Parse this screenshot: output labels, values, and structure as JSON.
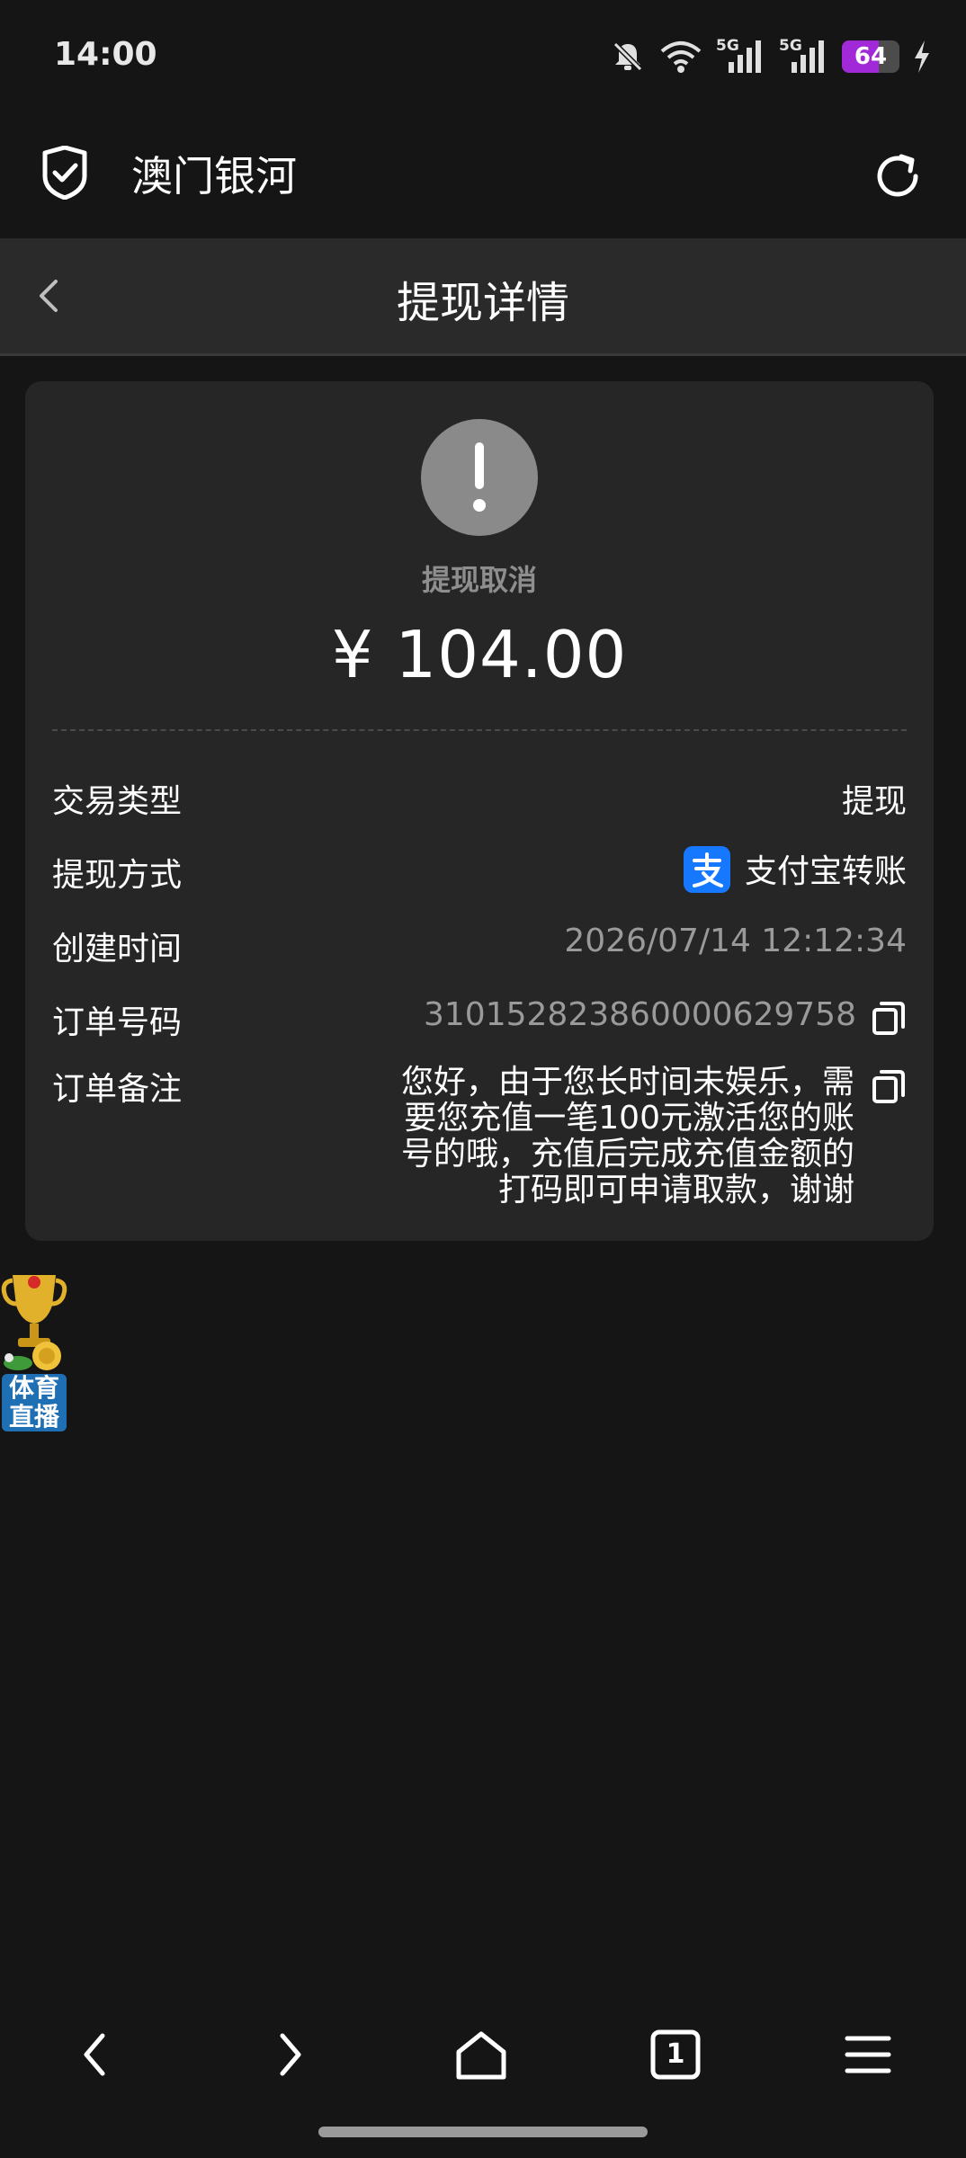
{
  "status_bar": {
    "time": "14:00",
    "signal_label_1": "5G",
    "signal_label_2": "5G",
    "battery_level": "64",
    "battery_fraction": 0.64,
    "icons": [
      "bell-off-icon",
      "wifi-icon",
      "signal-5g-icon",
      "signal-5g-icon",
      "battery-icon",
      "charging-bolt-icon"
    ]
  },
  "app_header": {
    "title": "澳门银河",
    "icons": [
      "shield-check-icon",
      "refresh-icon"
    ]
  },
  "page_header": {
    "title": "提现详情",
    "back_icon": "chevron-left-icon"
  },
  "detail": {
    "status_icon": "exclamation-icon",
    "status_text": "提现取消",
    "amount": "¥ 104.00",
    "rows": [
      {
        "label": "交易类型",
        "value": "提现"
      },
      {
        "label": "提现方式",
        "value": "支付宝转账",
        "icon": "alipay-icon"
      },
      {
        "label": "创建时间",
        "value": "2026/07/14 12:12:34"
      },
      {
        "label": "订单号码",
        "value": "31015282386000062975​8",
        "icon": "copy-icon"
      },
      {
        "label": "订单备注",
        "value": "您好，由于您长时间未娱乐，需要您充值一笔100元激活您的账号的哦，充值后完成充值金额的打码即可申请取款，谢谢",
        "icon": "copy-icon"
      }
    ]
  },
  "floating_badge": {
    "label": "体育直播",
    "icon": "trophy-icon"
  },
  "nav_bar": {
    "tab_count": "1",
    "icons": [
      "back-arrow-icon",
      "forward-arrow-icon",
      "home-icon",
      "tabs-icon",
      "menu-icon"
    ]
  },
  "colors": {
    "background": "#151515",
    "card": "#262626",
    "alipay_blue": "#1677ff",
    "battery_purple": "#a129d8"
  }
}
